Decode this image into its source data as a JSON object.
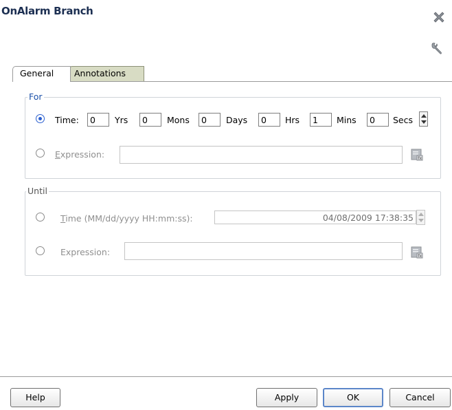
{
  "dialog": {
    "title": "OnAlarm Branch"
  },
  "tabs": [
    {
      "label": "General"
    },
    {
      "label": "Annotations"
    }
  ],
  "for_group": {
    "legend": "For",
    "time": {
      "label": "Time:",
      "selected": true,
      "units": [
        {
          "value": "0",
          "label": "Yrs"
        },
        {
          "value": "0",
          "label": "Mons"
        },
        {
          "value": "0",
          "label": "Days"
        },
        {
          "value": "0",
          "label": "Hrs"
        },
        {
          "value": "1",
          "label": "Mins"
        },
        {
          "value": "0",
          "label": "Secs"
        }
      ]
    },
    "expression": {
      "label": "Expression:",
      "value": "",
      "selected": false
    }
  },
  "until_group": {
    "legend": "Until",
    "time": {
      "label": "Time (MM/dd/yyyy HH:mm:ss):",
      "value": "04/08/2009 17:38:35",
      "selected": false
    },
    "expression": {
      "label": "Expression:",
      "value": "",
      "selected": false
    }
  },
  "footer": {
    "help": "Help",
    "apply": "Apply",
    "ok": "OK",
    "cancel": "Cancel"
  }
}
